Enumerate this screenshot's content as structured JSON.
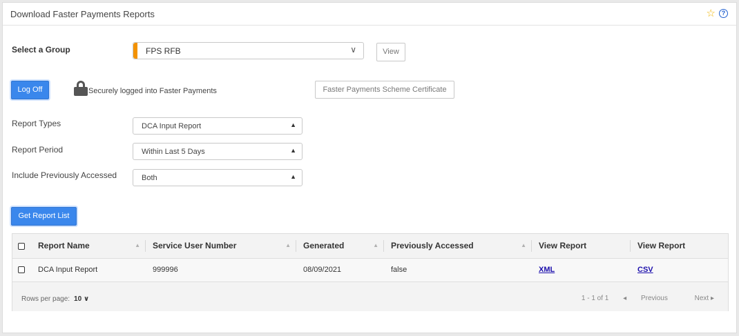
{
  "header": {
    "title": "Download Faster Payments Reports",
    "star_icon": "☆",
    "help_icon": "?"
  },
  "group": {
    "label": "Select a Group",
    "selected": "FPS RFB",
    "view_label": "View"
  },
  "session": {
    "logoff_label": "Log Off",
    "status_text": "Securely logged into Faster Payments",
    "certificate_label": "Faster Payments Scheme Certificate"
  },
  "filters": {
    "report_types": {
      "label": "Report Types",
      "value": "DCA Input Report"
    },
    "report_period": {
      "label": "Report Period",
      "value": "Within Last 5 Days"
    },
    "previously_accessed": {
      "label": "Include Previously Accessed",
      "value": "Both"
    }
  },
  "actions": {
    "get_report_list_label": "Get Report List"
  },
  "table": {
    "columns": [
      "Report Name",
      "Service User Number",
      "Generated",
      "Previously Accessed",
      "View Report",
      "View Report"
    ],
    "rows": [
      {
        "report_name": "DCA Input Report",
        "service_user_number": "999996",
        "generated": "08/09/2021",
        "previously_accessed": "false",
        "xml": "XML",
        "csv": "CSV"
      }
    ],
    "footer": {
      "rows_per_page_label": "Rows per page:",
      "rows_per_page_value": "10",
      "range": "1 - 1 of 1",
      "previous": "Previous",
      "next": "Next"
    }
  },
  "colors": {
    "accent": "#f39200",
    "primary": "#3a87ec",
    "link": "#1a0dab"
  }
}
